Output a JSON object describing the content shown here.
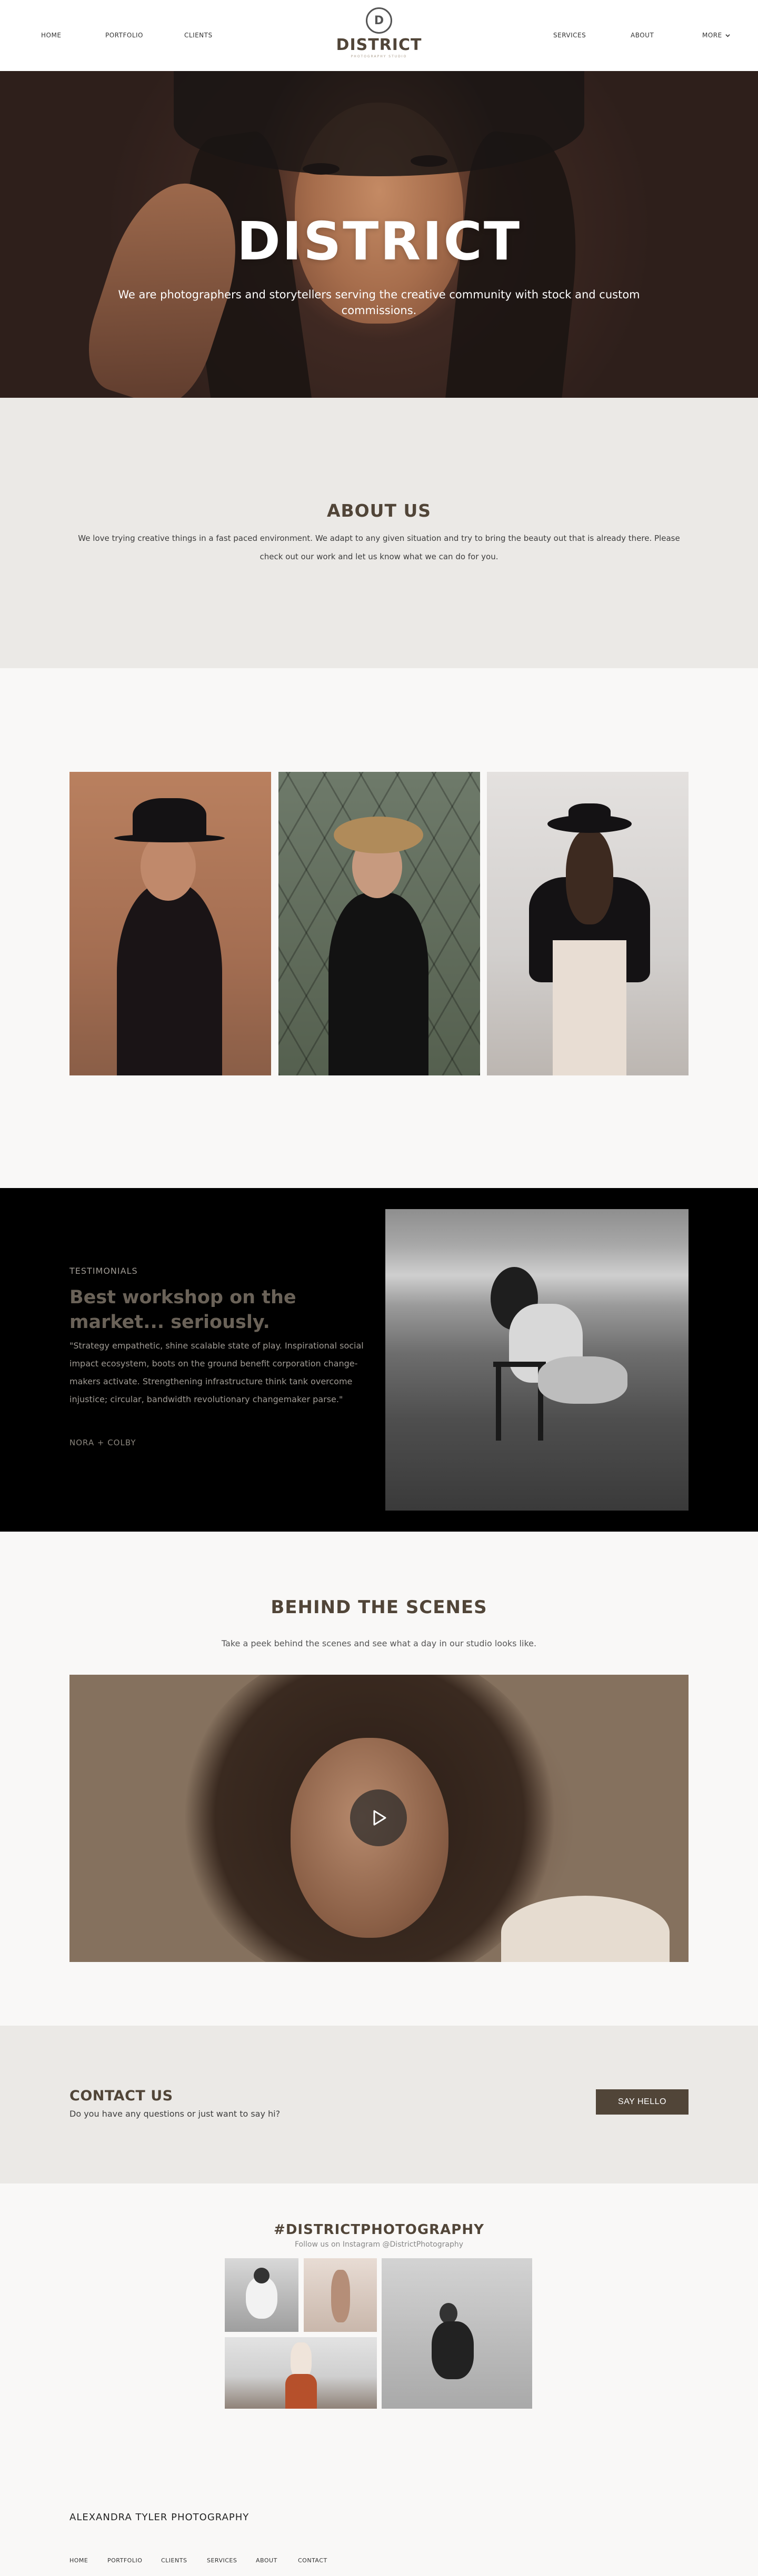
{
  "nav": {
    "left": [
      "HOME",
      "PORTFOLIO",
      "CLIENTS"
    ],
    "right": [
      "SERVICES",
      "ABOUT"
    ],
    "more": "MORE"
  },
  "logo": {
    "initial": "D",
    "word": "DISTRICT",
    "tagline": "PHOTOGRAPHY STUDIO"
  },
  "hero": {
    "title": "DISTRICT",
    "subtitle": "We are photographers and storytellers serving the creative community with stock and custom commissions."
  },
  "about": {
    "title": "ABOUT US",
    "text": "We love trying creative things in a fast paced environment. We adapt to any given situation and try to bring the beauty out that is already there. Please check out our work and let us know what we can do for you."
  },
  "testimonials": {
    "label": "TESTIMONIALS",
    "heading": "Best workshop on the market... seriously.",
    "quote": "\"Strategy empathetic, shine scalable state of play. Inspirational social impact ecosystem, boots on the ground benefit corporation change-makers activate. Strengthening infrastructure think tank overcome injustice; circular, bandwidth revolutionary changemaker parse.\"",
    "author": "NORA + COLBY"
  },
  "behind": {
    "title": "BEHIND THE SCENES",
    "subtitle": "Take a peek behind the scenes and see what a day in our studio looks like."
  },
  "contact": {
    "title": "CONTACT US",
    "subtitle": "Do you have any questions or just want to say hi?",
    "button": "SAY HELLO"
  },
  "instagram": {
    "title": "#DISTRICTPHOTOGRAPHY",
    "subtitle": "Follow us on Instagram @DistrictPhotography"
  },
  "footer": {
    "brand": "ALEXANDRA TYLER PHOTOGRAPHY",
    "links": [
      "HOME",
      "PORTFOLIO",
      "CLIENTS",
      "SERVICES",
      "ABOUT",
      "CONTACT"
    ]
  },
  "icons": {
    "more": "chevron-down-icon",
    "video": "play-icon"
  },
  "colors": {
    "brand": "#514538",
    "band": "#ebe9e6",
    "dark": "#000000"
  }
}
